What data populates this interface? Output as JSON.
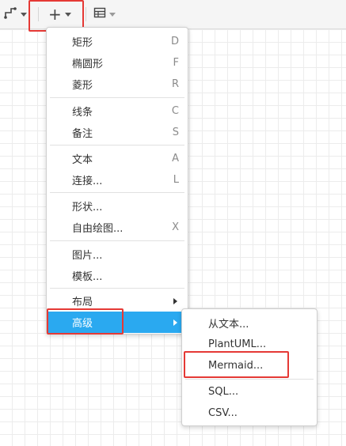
{
  "icons": {
    "waypoint": "waypoint-connector-icon",
    "plus": "plus-icon",
    "table": "table-icon",
    "caret": "caret-down-icon",
    "submenu": "submenu-arrow-icon"
  },
  "colors": {
    "highlight": "#e53935",
    "menu_active": "#2aa9f0",
    "shortcut": "#8a8a8a"
  },
  "toolbar": {
    "plus_symbol": "+"
  },
  "menu": {
    "items": [
      {
        "label": "矩形",
        "shortcut": "D"
      },
      {
        "label": "椭圆形",
        "shortcut": "F"
      },
      {
        "label": "菱形",
        "shortcut": "R"
      },
      {
        "label": "线条",
        "shortcut": "C"
      },
      {
        "label": "备注",
        "shortcut": "S"
      },
      {
        "label": "文本",
        "shortcut": "A"
      },
      {
        "label": "连接...",
        "shortcut": "L"
      },
      {
        "label": "形状...",
        "shortcut": ""
      },
      {
        "label": "自由绘图...",
        "shortcut": "X"
      },
      {
        "label": "图片...",
        "shortcut": ""
      },
      {
        "label": "模板...",
        "shortcut": ""
      },
      {
        "label": "布局",
        "shortcut": ""
      },
      {
        "label": "高级",
        "shortcut": ""
      }
    ]
  },
  "submenu": {
    "items": [
      {
        "label": "从文本..."
      },
      {
        "label": "PlantUML..."
      },
      {
        "label": "Mermaid..."
      },
      {
        "label": "SQL..."
      },
      {
        "label": "CSV..."
      }
    ]
  }
}
